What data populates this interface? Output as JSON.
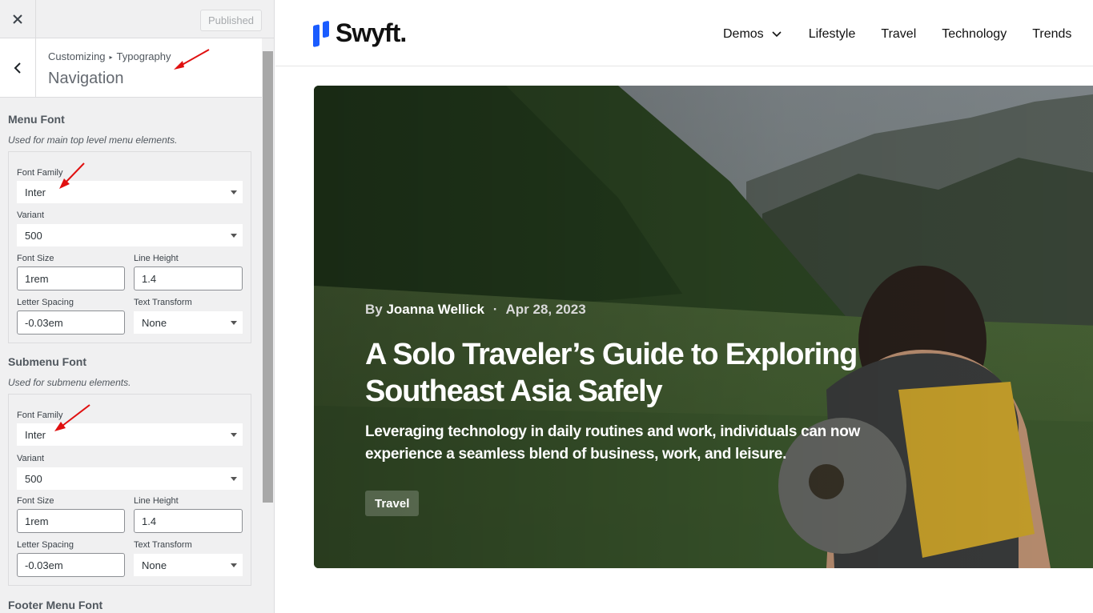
{
  "topbar": {
    "publish_label": "Published"
  },
  "section": {
    "breadcrumb_root": "Customizing",
    "breadcrumb_parent": "Typography",
    "title": "Navigation"
  },
  "menu_font": {
    "title": "Menu Font",
    "description": "Used for main top level menu elements.",
    "font_family_label": "Font Family",
    "font_family": "Inter",
    "variant_label": "Variant",
    "variant": "500",
    "font_size_label": "Font Size",
    "font_size": "1rem",
    "line_height_label": "Line Height",
    "line_height": "1.4",
    "letter_spacing_label": "Letter Spacing",
    "letter_spacing": "-0.03em",
    "text_transform_label": "Text Transform",
    "text_transform": "None"
  },
  "submenu_font": {
    "title": "Submenu Font",
    "description": "Used for submenu elements.",
    "font_family_label": "Font Family",
    "font_family": "Inter",
    "variant_label": "Variant",
    "variant": "500",
    "font_size_label": "Font Size",
    "font_size": "1rem",
    "line_height_label": "Line Height",
    "line_height": "1.4",
    "letter_spacing_label": "Letter Spacing",
    "letter_spacing": "-0.03em",
    "text_transform_label": "Text Transform",
    "text_transform": "None"
  },
  "footer_menu_font": {
    "title": "Footer Menu Font"
  },
  "site": {
    "logo_text": "Swyft.",
    "nav": [
      "Demos",
      "Lifestyle",
      "Travel",
      "Technology",
      "Trends"
    ],
    "brand_color": "#1a5cff"
  },
  "hero": {
    "by": "By",
    "author": "Joanna Wellick",
    "date": "Apr 28, 2023",
    "title": "A Solo Traveler’s Guide to Exploring Southeast Asia Safely",
    "excerpt": "Leveraging technology in daily routines and work, individuals can now experience a seamless blend of business, work, and leisure.",
    "tag": "Travel"
  }
}
